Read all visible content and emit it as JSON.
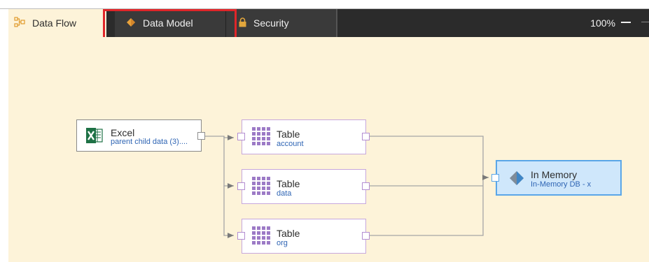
{
  "tabs": {
    "data_flow": "Data Flow",
    "data_model": "Data Model",
    "security": "Security"
  },
  "zoom": {
    "level": "100%"
  },
  "nodes": {
    "excel": {
      "title": "Excel",
      "subtitle": "parent child data (3)...."
    },
    "tables": [
      {
        "title": "Table",
        "subtitle": "account"
      },
      {
        "title": "Table",
        "subtitle": "data"
      },
      {
        "title": "Table",
        "subtitle": "org"
      }
    ],
    "in_memory": {
      "title": "In Memory",
      "subtitle": "In-Memory DB - x"
    }
  },
  "colors": {
    "tab_bar": "#2b2b2b",
    "canvas": "#fdf3d9",
    "highlight": "#e0262a",
    "table_border": "#c7a7dc",
    "memory_fill": "#cfe7fb",
    "memory_border": "#5aa6e8",
    "excel_green": "#1e7145"
  },
  "icons": {
    "data_flow": "dataflow-icon",
    "data_model": "diamond-icon",
    "security": "lock-icon",
    "excel": "excel-icon",
    "table": "table-grid-icon",
    "in_memory": "diamond-icon"
  }
}
